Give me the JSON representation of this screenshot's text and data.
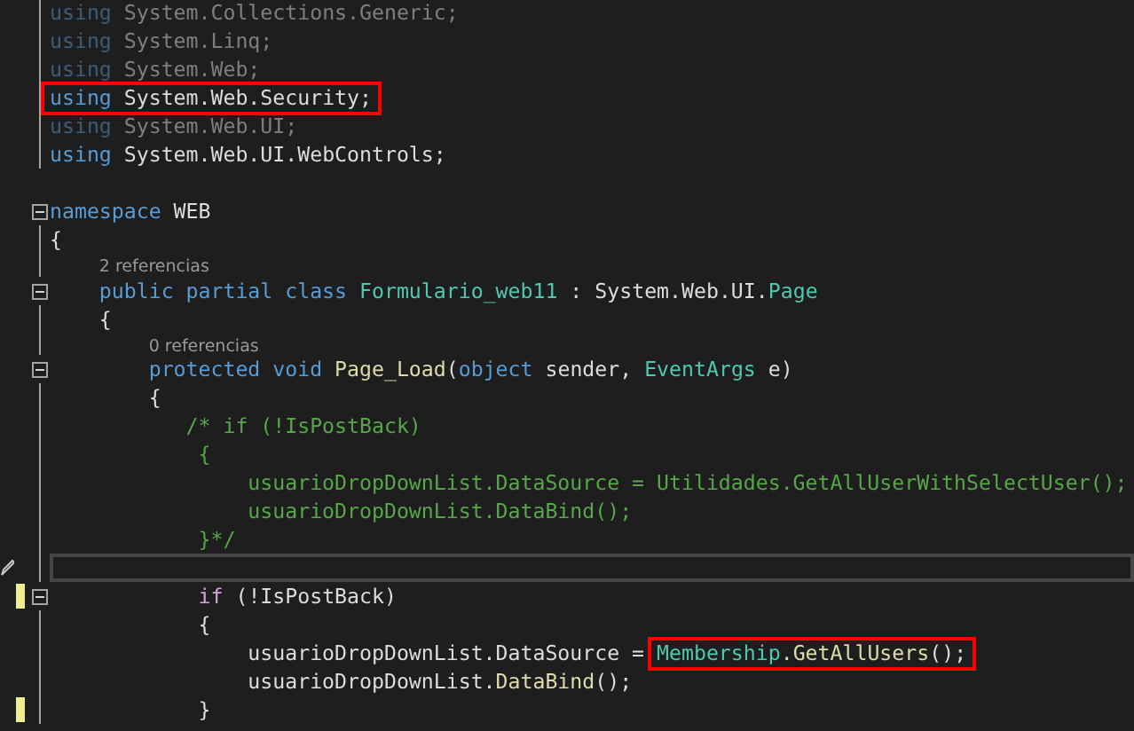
{
  "editor": {
    "lines": [
      {
        "dimmed": true,
        "fold": false,
        "changed": false,
        "current": false,
        "tokens": [
          {
            "text": "using",
            "kind": "keyword"
          },
          {
            "text": " System.Collections.Generic;",
            "kind": "plain"
          }
        ]
      },
      {
        "dimmed": true,
        "fold": false,
        "changed": false,
        "current": false,
        "tokens": [
          {
            "text": "using",
            "kind": "keyword"
          },
          {
            "text": " System.Linq;",
            "kind": "plain"
          }
        ]
      },
      {
        "dimmed": true,
        "fold": false,
        "changed": false,
        "current": false,
        "tokens": [
          {
            "text": "using",
            "kind": "keyword"
          },
          {
            "text": " System.Web;",
            "kind": "plain"
          }
        ]
      },
      {
        "dimmed": false,
        "fold": false,
        "changed": false,
        "current": false,
        "marked": [
          {
            "text": "using",
            "kind": "keyword"
          },
          {
            "text": " System.Web.Security;",
            "kind": "plain"
          }
        ]
      },
      {
        "dimmed": true,
        "fold": false,
        "changed": false,
        "current": false,
        "tokens": [
          {
            "text": "using",
            "kind": "keyword"
          },
          {
            "text": " System.Web.UI;",
            "kind": "plain"
          }
        ]
      },
      {
        "dimmed": false,
        "fold": false,
        "changed": false,
        "current": false,
        "tokens": [
          {
            "text": "using",
            "kind": "keyword"
          },
          {
            "text": " System.Web.UI.WebControls;",
            "kind": "plain"
          }
        ]
      },
      {
        "fold": false,
        "changed": false,
        "current": false
      },
      {
        "dimmed": false,
        "fold": true,
        "changed": false,
        "current": false,
        "tokens": [
          {
            "text": "namespace",
            "kind": "keyword"
          },
          {
            "text": " WEB",
            "kind": "plain"
          }
        ]
      },
      {
        "dimmed": false,
        "fold": false,
        "changed": false,
        "current": false,
        "tokens": [
          {
            "text": "{",
            "kind": "plain"
          }
        ]
      },
      {
        "dimmed": false,
        "fold": false,
        "changed": false,
        "current": false,
        "tokens": [
          {
            "text": "    2 referencias",
            "kind": "codelens"
          }
        ]
      },
      {
        "dimmed": false,
        "fold": true,
        "changed": false,
        "current": false,
        "tokens": [
          {
            "text": "    public partial class ",
            "kind": "keyword"
          },
          {
            "text": "Formulario_web11",
            "kind": "type"
          },
          {
            "text": " : System.Web.UI.",
            "kind": "plain"
          },
          {
            "text": "Page",
            "kind": "type"
          }
        ]
      },
      {
        "dimmed": false,
        "fold": false,
        "changed": false,
        "current": false,
        "tokens": [
          {
            "text": "    {",
            "kind": "plain"
          }
        ]
      },
      {
        "dimmed": false,
        "fold": false,
        "changed": false,
        "current": false,
        "tokens": [
          {
            "text": "        0 referencias",
            "kind": "codelens"
          }
        ]
      },
      {
        "dimmed": false,
        "fold": true,
        "changed": false,
        "current": false,
        "tokens": [
          {
            "text": "        protected void ",
            "kind": "keyword"
          },
          {
            "text": "Page_Load",
            "kind": "method"
          },
          {
            "text": "(",
            "kind": "plain"
          },
          {
            "text": "object",
            "kind": "keyword"
          },
          {
            "text": " sender, ",
            "kind": "plain"
          },
          {
            "text": "EventArgs",
            "kind": "type"
          },
          {
            "text": " e)",
            "kind": "plain"
          }
        ]
      },
      {
        "dimmed": false,
        "fold": false,
        "changed": false,
        "current": false,
        "tokens": [
          {
            "text": "        {",
            "kind": "plain"
          }
        ]
      },
      {
        "dimmed": false,
        "fold": false,
        "changed": false,
        "current": false,
        "tokens": [
          {
            "text": "           /* if (!IsPostBack)",
            "kind": "comment"
          }
        ]
      },
      {
        "dimmed": false,
        "fold": false,
        "changed": false,
        "current": false,
        "tokens": [
          {
            "text": "            {",
            "kind": "comment"
          }
        ]
      },
      {
        "dimmed": false,
        "fold": false,
        "changed": false,
        "current": false,
        "tokens": [
          {
            "text": "                usuarioDropDownList.DataSource = Utilidades.GetAllUserWithSelectUser();",
            "kind": "comment"
          }
        ]
      },
      {
        "dimmed": false,
        "fold": false,
        "changed": false,
        "current": false,
        "tokens": [
          {
            "text": "                usuarioDropDownList.DataBind();",
            "kind": "comment"
          }
        ]
      },
      {
        "dimmed": false,
        "fold": false,
        "changed": false,
        "current": false,
        "tokens": [
          {
            "text": "            }*/",
            "kind": "comment"
          }
        ]
      },
      {
        "fold": false,
        "changed": false,
        "current": true
      },
      {
        "dimmed": false,
        "fold": true,
        "changed": true,
        "current": false,
        "tokens": [
          {
            "text": "            if",
            "kind": "control"
          },
          {
            "text": " (!IsPostBack)",
            "kind": "plain"
          }
        ]
      },
      {
        "dimmed": false,
        "fold": false,
        "changed": false,
        "current": false,
        "tokens": [
          {
            "text": "            {",
            "kind": "plain"
          }
        ]
      },
      {
        "dimmed": false,
        "fold": false,
        "changed": false,
        "current": false,
        "tokens": [
          {
            "text": "                usuarioDropDownList.DataSource = ",
            "kind": "plain"
          }
        ],
        "marked": [
          {
            "text": "Membership",
            "kind": "type"
          },
          {
            "text": ".GetAllUsers",
            "kind": "method"
          },
          {
            "text": "();",
            "kind": "plain"
          }
        ]
      },
      {
        "dimmed": false,
        "fold": false,
        "changed": false,
        "current": false,
        "tokens": [
          {
            "text": "                usuarioDropDownList.",
            "kind": "plain"
          },
          {
            "text": "DataBind",
            "kind": "method"
          },
          {
            "text": "();",
            "kind": "plain"
          }
        ]
      },
      {
        "dimmed": false,
        "fold": false,
        "changed": true,
        "current": false,
        "tokens": [
          {
            "text": "            }",
            "kind": "plain"
          }
        ]
      }
    ]
  }
}
